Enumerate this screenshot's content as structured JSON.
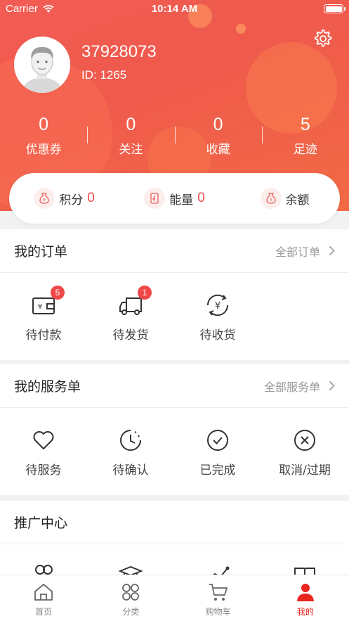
{
  "status_bar": {
    "carrier": "Carrier",
    "time": "10:14 AM"
  },
  "profile": {
    "username": "37928073",
    "user_id": "ID: 1265"
  },
  "stats": [
    {
      "value": "0",
      "label": "优惠券"
    },
    {
      "value": "0",
      "label": "关注"
    },
    {
      "value": "0",
      "label": "收藏"
    },
    {
      "value": "5",
      "label": "足迹"
    }
  ],
  "wallet": [
    {
      "label": "积分",
      "value": "0",
      "icon": "money-bag-icon"
    },
    {
      "label": "能量",
      "value": "0",
      "icon": "energy-card-icon"
    },
    {
      "label": "余额",
      "value": "",
      "icon": "money-bag-icon"
    }
  ],
  "orders": {
    "title": "我的订单",
    "link": "全部订单",
    "items": [
      {
        "label": "待付款",
        "badge": "5",
        "icon": "wallet-icon"
      },
      {
        "label": "待发货",
        "badge": "1",
        "icon": "truck-icon"
      },
      {
        "label": "待收货",
        "badge": "",
        "icon": "yen-refresh-icon"
      }
    ]
  },
  "services": {
    "title": "我的服务单",
    "link": "全部服务单",
    "items": [
      {
        "label": "待服务",
        "icon": "heart-icon"
      },
      {
        "label": "待确认",
        "icon": "clock-icon"
      },
      {
        "label": "已完成",
        "icon": "check-circle-icon"
      },
      {
        "label": "取消/过期",
        "icon": "x-circle-icon"
      }
    ]
  },
  "promotion": {
    "title": "推广中心"
  },
  "tabbar": [
    {
      "label": "首页",
      "icon": "home-icon",
      "active": false
    },
    {
      "label": "分类",
      "icon": "category-icon",
      "active": false
    },
    {
      "label": "购物车",
      "icon": "cart-icon",
      "active": false
    },
    {
      "label": "我的",
      "icon": "user-icon",
      "active": true
    }
  ],
  "colors": {
    "accent": "#ef5a4c",
    "badge": "#f04848",
    "active_tab": "#e8241d"
  }
}
